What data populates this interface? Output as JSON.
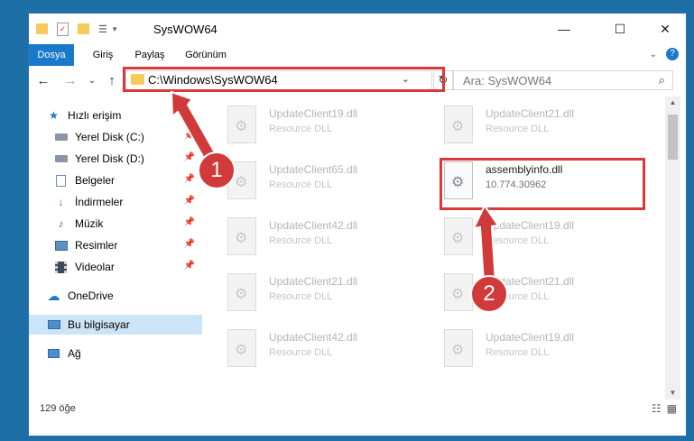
{
  "window": {
    "title": "SysWOW64",
    "controls": {
      "minimize": "—",
      "maximize": "☐",
      "close": "✕"
    }
  },
  "ribbon": {
    "tabs": [
      "Dosya",
      "Giriş",
      "Paylaş",
      "Görünüm"
    ]
  },
  "navigation": {
    "back": "←",
    "forward": "→",
    "recent": "⌄",
    "up": "↑",
    "address_path": "C:\\Windows\\SysWOW64",
    "address_dropdown": "⌄",
    "refresh": "↻",
    "search_placeholder": "Ara: SysWOW64",
    "search_icon": "⌕"
  },
  "sidebar": {
    "items": [
      {
        "label": "Hızlı erişim",
        "icon": "star-icon"
      },
      {
        "label": "Yerel Disk (C:)",
        "icon": "drive-icon"
      },
      {
        "label": "Yerel Disk (D:)",
        "icon": "drive-icon"
      },
      {
        "label": "Belgeler",
        "icon": "documents-icon"
      },
      {
        "label": "İndirmeler",
        "icon": "download-icon"
      },
      {
        "label": "Müzik",
        "icon": "music-icon"
      },
      {
        "label": "Resimler",
        "icon": "pictures-icon"
      },
      {
        "label": "Videolar",
        "icon": "videos-icon"
      },
      {
        "label": "OneDrive",
        "icon": "cloud-icon"
      },
      {
        "label": "Bu bilgisayar",
        "icon": "computer-icon"
      },
      {
        "label": "Ağ",
        "icon": "network-icon"
      }
    ]
  },
  "files": [
    {
      "name": "UpdateClient19.dll",
      "desc": "Resource DLL"
    },
    {
      "name": "UpdateClient21.dll",
      "desc": "Resource DLL"
    },
    {
      "name": "UpdateClient65.dll",
      "desc": "Resource DLL"
    },
    {
      "name": "assemblyinfo.dll",
      "desc": "10.774.30962"
    },
    {
      "name": "UpdateClient42.dll",
      "desc": "Resource DLL"
    },
    {
      "name": "UpdateClient19.dll",
      "desc": "Resource DLL"
    },
    {
      "name": "UpdateClient21.dll",
      "desc": "Resource DLL"
    },
    {
      "name": "UpdateClient21.dll",
      "desc": "Resource DLL"
    },
    {
      "name": "UpdateClient42.dll",
      "desc": "Resource DLL"
    },
    {
      "name": "UpdateClient19.dll",
      "desc": "Resource DLL"
    }
  ],
  "status": {
    "item_count": "129 öğe"
  },
  "callouts": {
    "one": "1",
    "two": "2"
  },
  "colors": {
    "accent": "#1979ca",
    "highlight": "#d9393a",
    "desktop": "#1d6fa5"
  }
}
